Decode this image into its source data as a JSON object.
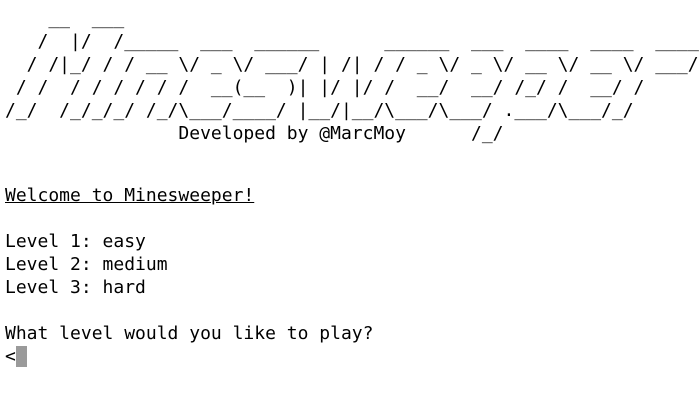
{
  "banner": {
    "ascii_art": "    __  ___                                                     \n   /  |/  /_____  ___  ______      ______  ___  ____  ____  _____\n  / /|_/ / / __ \\/ _ \\/ ___/ | /| / / _ \\/ _ \\/ __ \\/ __ \\/ ___/\n / /  / / / / / /  __(__  )| |/ |/ /  __/  __/ /_/ /  __/ /    \n/_/  /_/_/_/ /_/\\___/____/ |__/|__/\\___/\\___/ .___/\\___/_/     \n                Developed by @MarcMoy      /_/                 "
  },
  "welcome": "Welcome to Minesweeper!",
  "levels": [
    "Level 1: easy",
    "Level 2: medium",
    "Level 3: hard"
  ],
  "question": "What level would you like to play?",
  "prompt_symbol": "<",
  "colors": {
    "background": "#ffffff",
    "text": "#000000",
    "cursor": "#9a9a9a"
  }
}
